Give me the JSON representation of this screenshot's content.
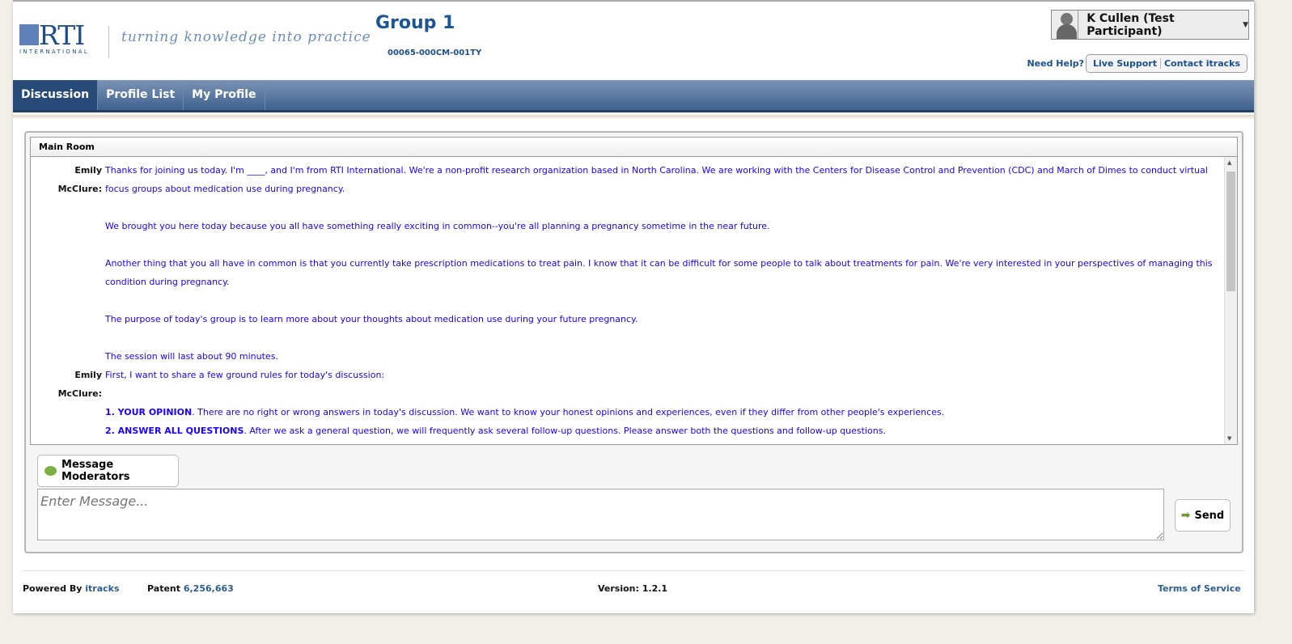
{
  "header": {
    "logo_text": "RTI",
    "logo_sub": "INTERNATIONAL",
    "tagline": "turning knowledge into practice",
    "title": "Group 1",
    "code": "00065-000CM-001TY",
    "user": "K Cullen (Test Participant)",
    "need_help": "Need Help?",
    "live_support": "Live Support",
    "contact": "Contact itracks"
  },
  "nav": {
    "tabs": [
      {
        "label": "Discussion",
        "active": true
      },
      {
        "label": "Profile List"
      },
      {
        "label": "My Profile"
      }
    ]
  },
  "room": {
    "title": "Main Room",
    "messages": [
      {
        "author": "Emily McClure:",
        "paragraphs": [
          "Thanks for joining us today. I'm ____, and I'm from RTI International. We're a non-profit research organization based in North Carolina. We are working with the Centers for Disease Control and Prevention (CDC) and March of Dimes to conduct virtual focus groups about medication use during pregnancy.",
          "",
          "We brought you here today because you all have something really exciting in common--you're all planning a pregnancy sometime in the near future.",
          "",
          "Another thing that you all have in common is that you currently take prescription medications to treat pain. I know that it can be difficult for some people to talk about treatments for pain. We're very interested in your perspectives of managing this condition during pregnancy.",
          "",
          "The purpose of today's group is to learn more about your thoughts about medication use during your future pregnancy.",
          "",
          "The session will last about 90 minutes."
        ]
      },
      {
        "author": "Emily McClure:",
        "paragraphs": [
          "First, I want to share a few ground rules for today's discussion:",
          ""
        ],
        "rules": [
          {
            "head": "1. YOUR OPINION",
            "body": ". There are no right or wrong answers in today's discussion. We want to know your honest opinions and experiences, even if they differ from other people's experiences."
          },
          {
            "head": "2. ANSWER ALL QUESTIONS",
            "body": ". After we ask a general question, we will frequently ask several follow-up questions. Please answer both the questions and follow-up questions."
          }
        ]
      }
    ]
  },
  "compose": {
    "message_moderators": "Message Moderators",
    "placeholder": "Enter Message...",
    "send": "Send"
  },
  "footer": {
    "powered_by": "Powered By",
    "itracks": "itracks",
    "patent": "Patent",
    "patent_no": "6,256,663",
    "version": "Version: 1.2.1",
    "terms": "Terms of Service"
  },
  "colors": {
    "brand": "#1b5594",
    "nav": "#3f628f",
    "message_text": "#1a00ff"
  }
}
